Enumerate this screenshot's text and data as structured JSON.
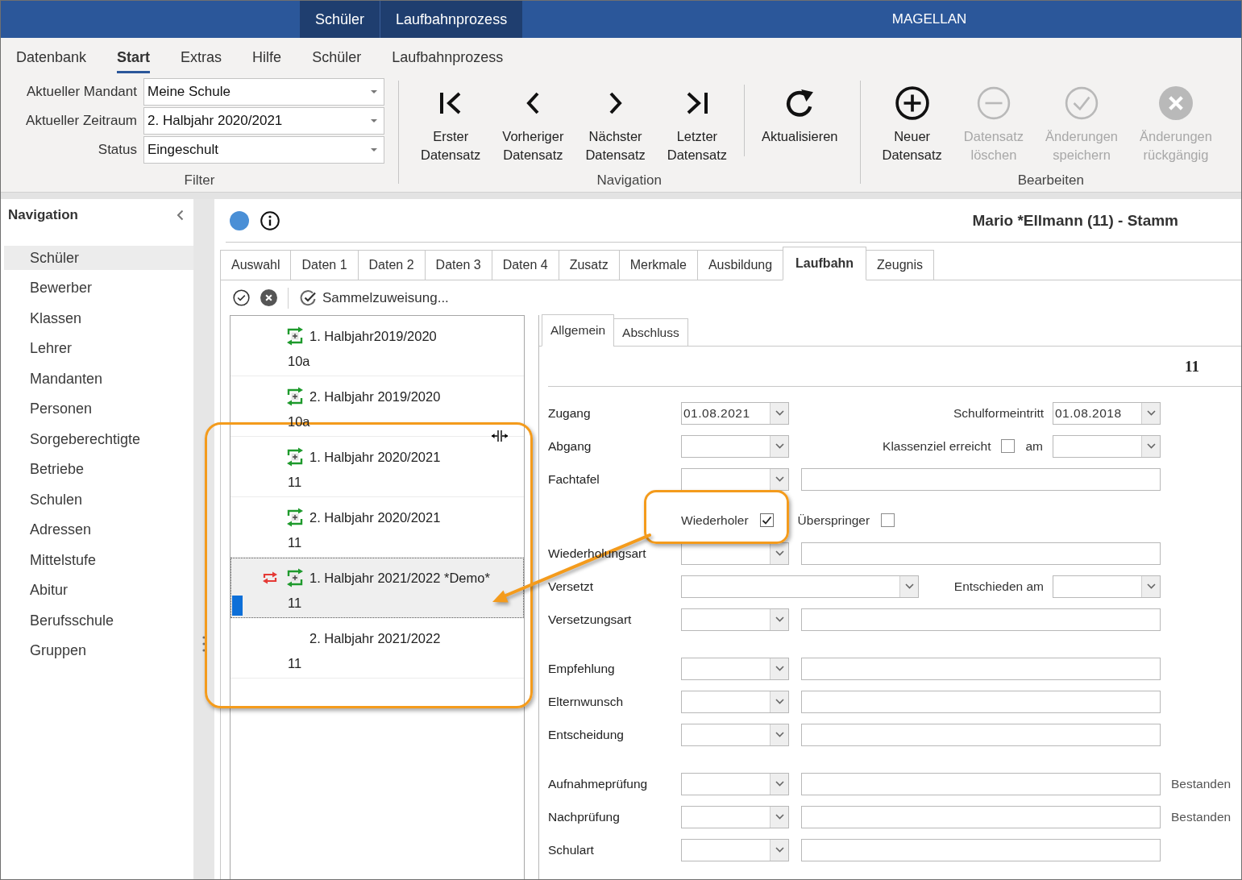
{
  "title_bar": {
    "context_tabs": [
      "Schüler",
      "Laufbahnprozess"
    ],
    "title": "MAGELLAN"
  },
  "menu": [
    {
      "label": "Datenbank",
      "selected": false
    },
    {
      "label": "Start",
      "selected": true
    },
    {
      "label": "Extras",
      "selected": false
    },
    {
      "label": "Hilfe",
      "selected": false
    },
    {
      "label": "Schüler",
      "selected": false
    },
    {
      "label": "Laufbahnprozess",
      "selected": false
    }
  ],
  "ribbon": {
    "groups": [
      {
        "kind": "fields",
        "title": "Filter",
        "fields": [
          {
            "label": "Aktueller Mandant",
            "value": "Meine Schule"
          },
          {
            "label": "Aktueller Zeitraum",
            "value": "2. Halbjahr 2020/2021"
          },
          {
            "label": "Status",
            "value": "Eingeschult"
          }
        ]
      },
      {
        "kind": "buttons",
        "title": "Navigation",
        "buttons": [
          {
            "kind": "first",
            "label": "Erster Datensatz",
            "disabled": false,
            "separated": false
          },
          {
            "kind": "previous",
            "label": "Vorheriger Datensatz",
            "disabled": false,
            "separated": false
          },
          {
            "kind": "next",
            "label": "Nächster Datensatz",
            "disabled": false,
            "separated": false
          },
          {
            "kind": "last",
            "label": "Letzter Datensatz",
            "disabled": false,
            "separated": false
          },
          {
            "kind": "refresh",
            "label": "Aktualisieren",
            "disabled": false,
            "separated": true
          }
        ]
      },
      {
        "kind": "buttons",
        "title": "Bearbeiten",
        "buttons": [
          {
            "kind": "new",
            "label": "Neuer Datensatz",
            "disabled": false,
            "separated": false
          },
          {
            "kind": "delete",
            "label": "Datensatz löschen",
            "disabled": true,
            "separated": false
          },
          {
            "kind": "save",
            "label": "Änderungen speichern",
            "disabled": true,
            "separated": false
          },
          {
            "kind": "undo",
            "label": "Änderungen rückgängig",
            "disabled": true,
            "separated": false
          }
        ]
      }
    ]
  },
  "navigation": {
    "title": "Navigation",
    "items": [
      {
        "label": "Schüler",
        "selected": true
      },
      {
        "label": "Bewerber",
        "selected": false
      },
      {
        "label": "Klassen",
        "selected": false
      },
      {
        "label": "Lehrer",
        "selected": false
      },
      {
        "label": "Mandanten",
        "selected": false
      },
      {
        "label": "Personen",
        "selected": false
      },
      {
        "label": "Sorgeberechtigte",
        "selected": false
      },
      {
        "label": "Betriebe",
        "selected": false
      },
      {
        "label": "Schulen",
        "selected": false
      },
      {
        "label": "Adressen",
        "selected": false
      },
      {
        "label": "Mittelstufe",
        "selected": false
      },
      {
        "label": "Abitur",
        "selected": false
      },
      {
        "label": "Berufsschule",
        "selected": false
      },
      {
        "label": "Gruppen",
        "selected": false
      }
    ]
  },
  "record": {
    "title": "Mario *Ellmann (11) - Stamm",
    "tabs": [
      {
        "label": "Auswahl",
        "selected": false
      },
      {
        "label": "Daten 1",
        "selected": false
      },
      {
        "label": "Daten 2",
        "selected": false
      },
      {
        "label": "Daten 3",
        "selected": false
      },
      {
        "label": "Daten 4",
        "selected": false
      },
      {
        "label": "Zusatz",
        "selected": false
      },
      {
        "label": "Merkmale",
        "selected": false
      },
      {
        "label": "Ausbildung",
        "selected": false
      },
      {
        "label": "Laufbahn",
        "selected": true
      },
      {
        "label": "Zeugnis",
        "selected": false
      }
    ]
  },
  "periods": {
    "toolbar_label": "Sammelzuweisung...",
    "items": [
      {
        "title": "1. Halbjahr2019/2020",
        "class": "10a",
        "assigned": true,
        "repeated": false,
        "current": false,
        "selected": false
      },
      {
        "title": "2. Halbjahr 2019/2020",
        "class": "10a",
        "assigned": true,
        "repeated": false,
        "current": false,
        "selected": false
      },
      {
        "title": "1. Halbjahr 2020/2021",
        "class": "11",
        "assigned": true,
        "repeated": false,
        "current": false,
        "selected": false
      },
      {
        "title": "2. Halbjahr 2020/2021",
        "class": "11",
        "assigned": true,
        "repeated": false,
        "current": false,
        "selected": false
      },
      {
        "title": "1. Halbjahr 2021/2022 *Demo*",
        "class": "11",
        "assigned": true,
        "repeated": true,
        "current": true,
        "selected": true
      },
      {
        "title": "2. Halbjahr 2021/2022",
        "class": "11",
        "assigned": false,
        "repeated": false,
        "current": false,
        "selected": false
      }
    ]
  },
  "form": {
    "tabs": [
      {
        "label": "Allgemein",
        "selected": true
      },
      {
        "label": "Abschluss",
        "selected": false
      }
    ],
    "header": "11",
    "sections": [
      {
        "rows": [
          {
            "kind": "date_pair",
            "label": "Zugang",
            "value": "01.08.2021",
            "wide": false,
            "right_label": "Schulformeintritt",
            "right_value": "01.08.2018"
          },
          {
            "kind": "check_date",
            "label": "Abgang",
            "right_label": "Klassenziel erreicht",
            "checked": false,
            "connector": "am"
          },
          {
            "kind": "combo_text",
            "label": "Fachtafel"
          },
          {
            "kind": "checks",
            "checks": [
              {
                "label": "Wiederholer",
                "checked": true
              },
              {
                "label": "Überspringer",
                "checked": false
              }
            ]
          },
          {
            "kind": "combo_text",
            "label": "Wiederholungsart"
          },
          {
            "kind": "date_pair",
            "label": "Versetzt",
            "wide": true,
            "right_label": "Entschieden am"
          },
          {
            "kind": "combo_text",
            "label": "Versetzungsart"
          }
        ]
      },
      {
        "rows": [
          {
            "kind": "combo_text",
            "label": "Empfehlung"
          },
          {
            "kind": "combo_text",
            "label": "Elternwunsch"
          },
          {
            "kind": "combo_text",
            "label": "Entscheidung"
          }
        ]
      },
      {
        "rows": [
          {
            "kind": "combo_text",
            "label": "Aufnahmeprüfung",
            "note": "Bestanden"
          },
          {
            "kind": "combo_text",
            "label": "Nachprüfung",
            "note": "Bestanden"
          },
          {
            "kind": "combo_text",
            "label": "Schulart"
          }
        ]
      }
    ]
  }
}
